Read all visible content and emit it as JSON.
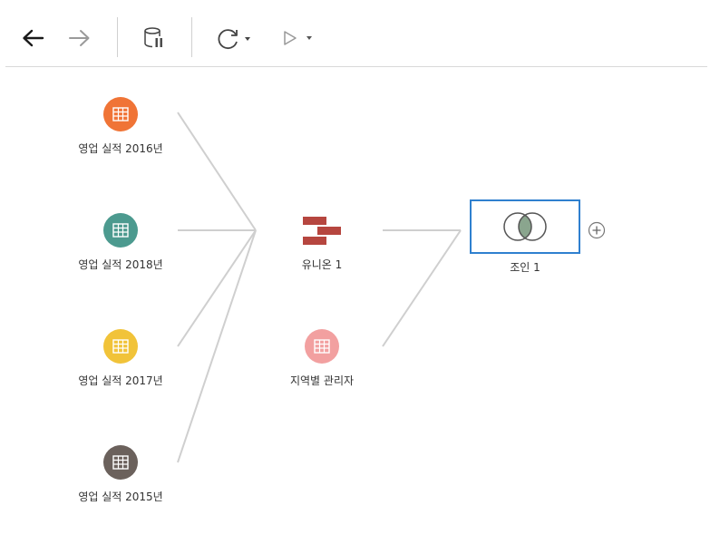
{
  "toolbar": {
    "back": {
      "icon": "arrow-left-icon",
      "color": "#1a1a1a"
    },
    "forward": {
      "icon": "arrow-right-icon",
      "color": "#9a9a9a"
    },
    "data_source": {
      "icon": "database-pause-icon"
    },
    "refresh": {
      "icon": "refresh-icon"
    },
    "run": {
      "icon": "play-icon"
    }
  },
  "flow": {
    "inputs": [
      {
        "label": "영업 실적 2016년",
        "color": "#f07436",
        "icon": "table-icon"
      },
      {
        "label": "영업 실적 2018년",
        "color": "#4c9a8f",
        "icon": "table-icon"
      },
      {
        "label": "영업 실적 2017년",
        "color": "#f1c339",
        "icon": "table-icon"
      },
      {
        "label": "영업 실적 2015년",
        "color": "#6b615c",
        "icon": "table-icon"
      }
    ],
    "union": {
      "label": "유니온 1",
      "color": "#b6463f",
      "icon": "union-icon"
    },
    "manager": {
      "label": "지역별 관리자",
      "color": "#f2a0a0",
      "icon": "table-icon"
    },
    "join": {
      "label": "조인 1",
      "icon": "inner-join-icon",
      "border_color": "#2f80cf"
    },
    "add": {
      "icon": "add-step-icon"
    }
  }
}
